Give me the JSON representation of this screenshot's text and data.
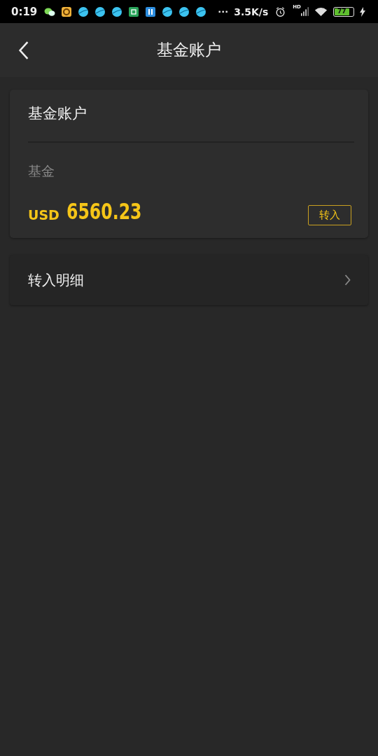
{
  "status_bar": {
    "time": "0:19",
    "notification_icons": [
      {
        "kind": "chat"
      },
      {
        "kind": "orange"
      },
      {
        "kind": "globe"
      },
      {
        "kind": "globe"
      },
      {
        "kind": "globe"
      },
      {
        "kind": "green"
      },
      {
        "kind": "book"
      },
      {
        "kind": "globe"
      },
      {
        "kind": "globe"
      },
      {
        "kind": "globe"
      }
    ],
    "more": "···",
    "speed": "3.5K/s",
    "network": "HD",
    "battery": "77"
  },
  "header": {
    "title": "基金账户"
  },
  "account_card": {
    "title": "基金账户",
    "label": "基金",
    "currency": "USD",
    "amount": "6560.23",
    "button": "转入"
  },
  "list": [
    {
      "label": "转入明细"
    }
  ]
}
